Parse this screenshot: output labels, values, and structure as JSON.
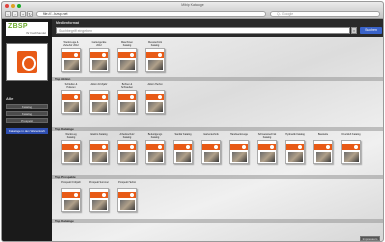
{
  "window": {
    "title": "Mibip Kataoge",
    "url": "file:///...bzsp.net",
    "toolbar_search_placeholder": "Q- Google"
  },
  "sidebar": {
    "logo_text": "ZBSP",
    "logo_subtext": "Ihr Fachhandel",
    "section_title": "Alle",
    "buttons": [
      "Katalog",
      "Katalog",
      "Prospekt"
    ],
    "action_button": "Kataloge in den Warenkorb"
  },
  "search": {
    "label": "Medienformat",
    "placeholder": "Suchbegriff eingeben",
    "clear": "×",
    "button": "Suchen"
  },
  "sections": [
    {
      "title": "",
      "items": [
        "Werkzeuge & Zubehör 2012",
        "Gartengeräte 2012",
        "Maschinen Katalog",
        "Messtechnik Katalog"
      ]
    },
    {
      "title": "Top Aktion",
      "items": [
        "Schleifen & Polieren",
        "Aktion Frühjahr",
        "Bohren & Schrauben",
        "Aktion Herbst"
      ]
    },
    {
      "title": "Top Kataloge",
      "items": [
        "Werkzeug Katalog",
        "Elektro Katalog",
        "Arbeitsschutz Katalog",
        "Befestigungs Katalog",
        "Sanitär Katalog",
        "Gartentechnik",
        "Handwerkzeuge",
        "Schweisstechnik Katalog",
        "Hydraulik Katalog",
        "Baustelle",
        "Druckluft Katalog"
      ]
    },
    {
      "title": "Top Prospekte",
      "items": [
        "Prospekt Frühjahr",
        "Prospekt Sommer",
        "Prospekt Herbst"
      ]
    },
    {
      "title": "Top Kataloge",
      "items": []
    }
  ],
  "bottom_button": "Impressum"
}
